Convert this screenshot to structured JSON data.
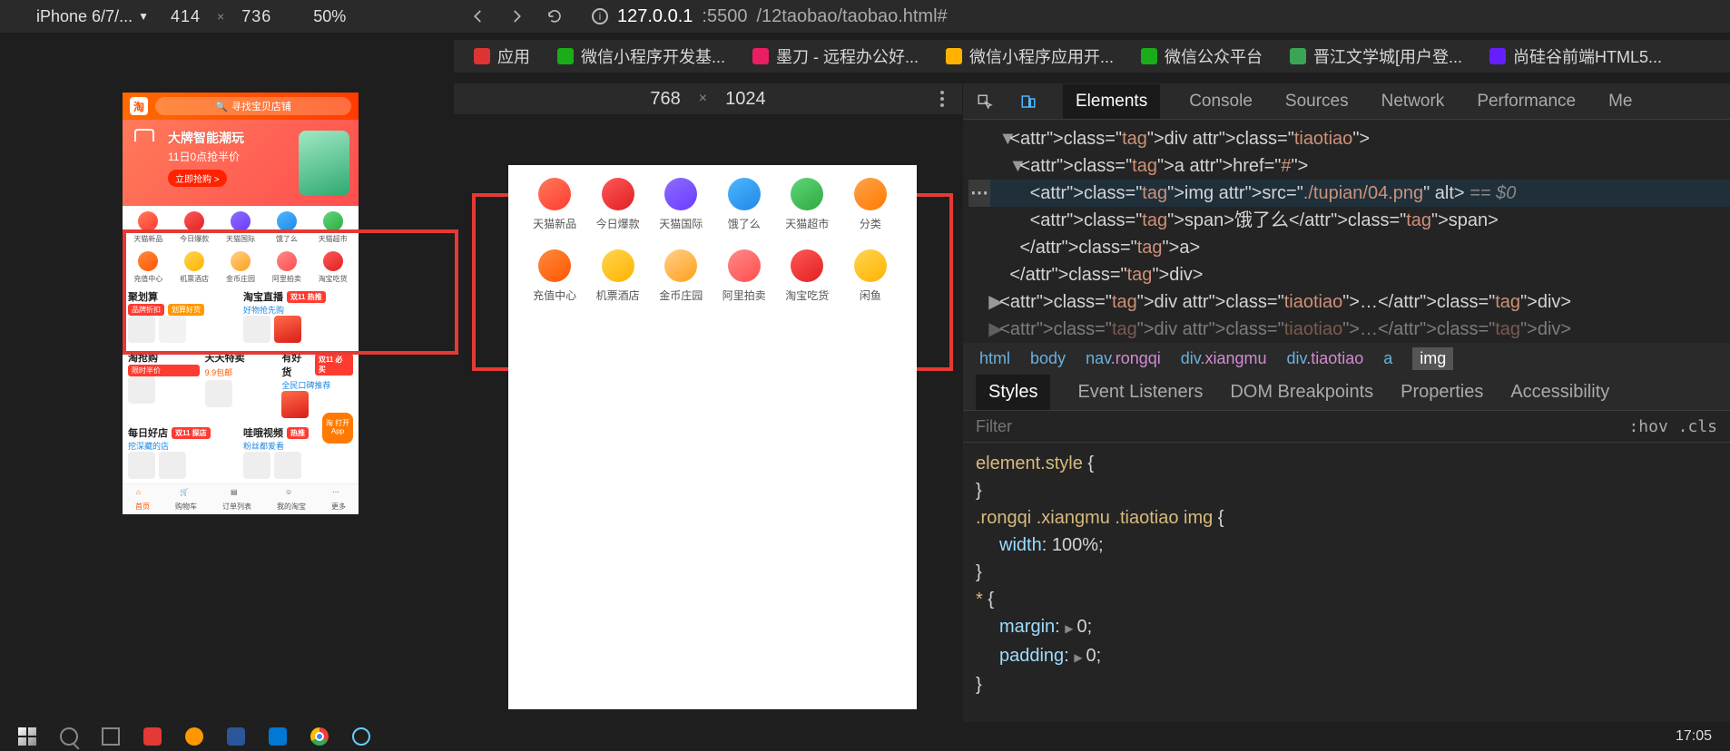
{
  "left_toolbar": {
    "device": "iPhone 6/7/...",
    "w": "414",
    "h": "736",
    "zoom": "50%"
  },
  "browser": {
    "url_host": "127.0.0.1",
    "url_port": ":5500",
    "url_path": "/12taobao/taobao.html#",
    "bookmarks": [
      {
        "label": "应用",
        "color": "#d33"
      },
      {
        "label": "微信小程序开发基...",
        "color": "#1aad19"
      },
      {
        "label": "墨刀 - 远程办公好...",
        "color": "#e91e63"
      },
      {
        "label": "微信小程序应用开...",
        "color": "#ffb300"
      },
      {
        "label": "微信公众平台",
        "color": "#1aad19"
      },
      {
        "label": "晋江文学城[用户登...",
        "color": "#3aa655"
      },
      {
        "label": "尚硅谷前端HTML5...",
        "color": "#651fff"
      }
    ]
  },
  "mid_toolbar": {
    "w": "768",
    "h": "1024"
  },
  "phone": {
    "logo": "淘",
    "search_placeholder": "寻找宝贝店铺",
    "banner": {
      "big": "大牌智能潮玩",
      "sub": "11日0点抢半价",
      "btn": "立即抢购 >"
    },
    "grid1": [
      {
        "label": "天猫新品",
        "cls": "c-red"
      },
      {
        "label": "今日爆款",
        "cls": "c-red2"
      },
      {
        "label": "天猫国际",
        "cls": "c-purple"
      },
      {
        "label": "饿了么",
        "cls": "c-blue"
      },
      {
        "label": "天猫超市",
        "cls": "c-green"
      },
      {
        "label": "分类",
        "cls": "c-orange"
      }
    ],
    "grid2": [
      {
        "label": "充值中心",
        "cls": "c-orange2"
      },
      {
        "label": "机票酒店",
        "cls": "c-yellow"
      },
      {
        "label": "金币庄园",
        "cls": "c-gold"
      },
      {
        "label": "阿里拍卖",
        "cls": "c-pink"
      },
      {
        "label": "淘宝吃货",
        "cls": "c-red2"
      },
      {
        "label": "闲鱼",
        "cls": "c-yellow"
      }
    ],
    "sections": [
      {
        "title": "聚划算",
        "chip": "",
        "sub1": "品牌折扣",
        "sub2": "划算好货"
      },
      {
        "title": "淘宝直播",
        "chip": "双11 热推",
        "link": "好物抢先购"
      },
      {
        "title": "淘抢购",
        "sub1": "限时半价"
      },
      {
        "title": "天天特卖",
        "sub1": "9.9包邮"
      },
      {
        "title": "有好货",
        "chip": "双11 必买",
        "link": "全民口碑推荐"
      },
      {
        "title": "每日好店",
        "chip": "双11 探店",
        "link": "挖深藏的店"
      },
      {
        "title": "哇哦视频",
        "chip": "热推",
        "link": "粉丝都爱看"
      }
    ],
    "float": "淘\n打开App",
    "tabs": [
      {
        "label": "首页"
      },
      {
        "label": "购物车"
      },
      {
        "label": "订单列表"
      },
      {
        "label": "我的淘宝"
      },
      {
        "label": "更多"
      }
    ]
  },
  "tablet": {
    "grid1": [
      {
        "label": "天猫新品",
        "cls": "c-red"
      },
      {
        "label": "今日爆款",
        "cls": "c-red2"
      },
      {
        "label": "天猫国际",
        "cls": "c-purple"
      },
      {
        "label": "饿了么",
        "cls": "c-blue"
      },
      {
        "label": "天猫超市",
        "cls": "c-green"
      },
      {
        "label": "分类",
        "cls": "c-orange"
      }
    ],
    "grid2": [
      {
        "label": "充值中心",
        "cls": "c-orange2"
      },
      {
        "label": "机票酒店",
        "cls": "c-yellow"
      },
      {
        "label": "金币庄园",
        "cls": "c-gold"
      },
      {
        "label": "阿里拍卖",
        "cls": "c-pink"
      },
      {
        "label": "淘宝吃货",
        "cls": "c-red2"
      },
      {
        "label": "闲鱼",
        "cls": "c-yellow"
      }
    ]
  },
  "devtools": {
    "tabs": [
      "Elements",
      "Console",
      "Sources",
      "Network",
      "Performance",
      "Me"
    ],
    "active_tab": "Elements",
    "html_lines": [
      {
        "indent": 3,
        "open": true,
        "html": "<div class=\"tiaotiao\">"
      },
      {
        "indent": 4,
        "open": true,
        "html": "<a href=\"#\">"
      },
      {
        "indent": 5,
        "selected": true,
        "html": "<img src=\"./tupian/04.png\" alt>",
        "tail": " == $0",
        "dots": true
      },
      {
        "indent": 5,
        "html": "<span>饿了么</span>"
      },
      {
        "indent": 4,
        "html": "</a>"
      },
      {
        "indent": 3,
        "html": "</div>"
      },
      {
        "indent": 2,
        "closed": true,
        "html": "<div class=\"tiaotiao\">…</div>"
      },
      {
        "indent": 2,
        "closed": true,
        "dim": true,
        "html": "<div class=\"tiaotiao\">…</div>"
      }
    ],
    "breadcrumbs": [
      "html",
      "body",
      "nav.rongqi",
      "div.xiangmu",
      "div.tiaotiao",
      "a",
      "img"
    ],
    "style_tabs": [
      "Styles",
      "Event Listeners",
      "DOM Breakpoints",
      "Properties",
      "Accessibility"
    ],
    "active_style_tab": "Styles",
    "filter_placeholder": "Filter",
    "hov": ":hov  .cls",
    "rules": [
      {
        "selector": "element.style",
        "props": []
      },
      {
        "selector": ".rongqi .xiangmu .tiaotiao img",
        "props": [
          {
            "name": "width",
            "value": "100%"
          }
        ]
      },
      {
        "selector": "*",
        "props": [
          {
            "name": "margin",
            "value": "0",
            "expand": true
          },
          {
            "name": "padding",
            "value": "0",
            "expand": true
          }
        ]
      }
    ]
  },
  "clock": "17:05"
}
